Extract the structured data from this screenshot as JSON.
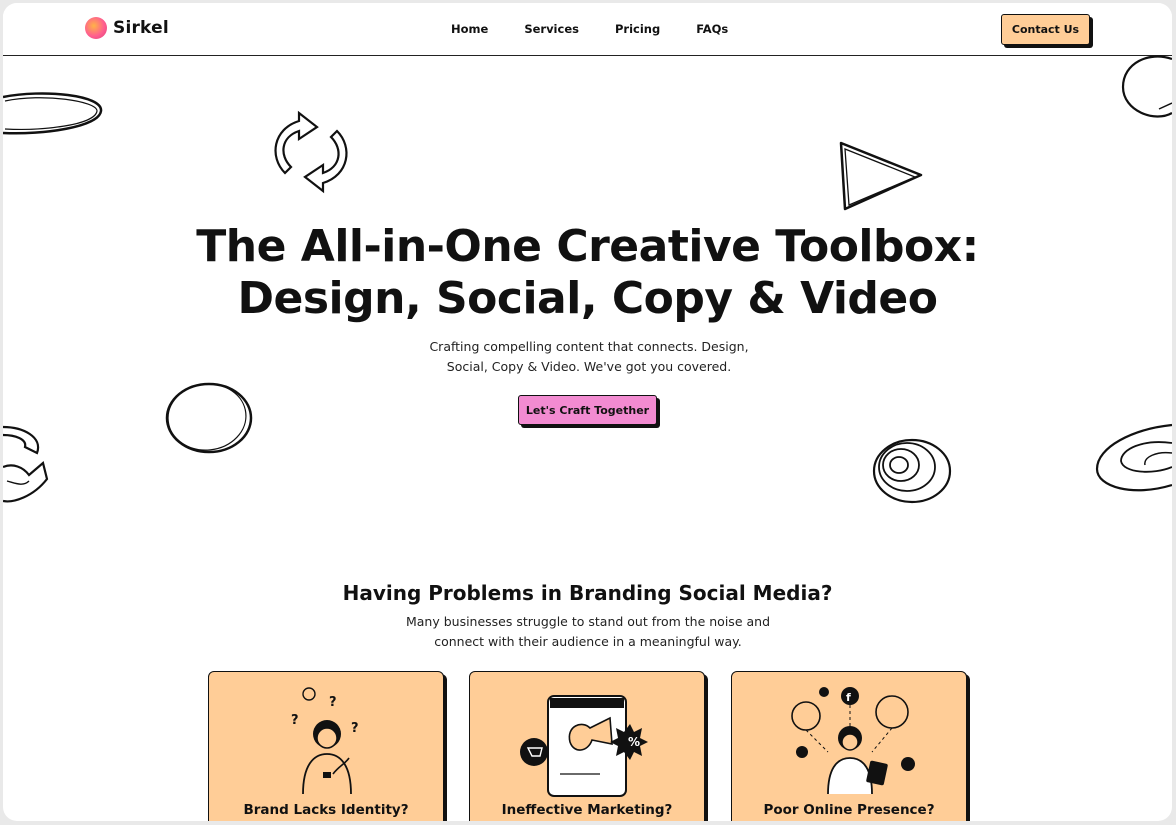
{
  "brand": {
    "name": "Sirkel"
  },
  "nav": {
    "items": [
      "Home",
      "Services",
      "Pricing",
      "FAQs"
    ]
  },
  "header": {
    "contact_label": "Contact Us"
  },
  "hero": {
    "title_line1": "The All-in-One Creative Toolbox:",
    "title_line2": "Design, Social, Copy & Video",
    "subtitle": "Crafting compelling content that connects. Design, Social, Copy & Video. We've got you covered.",
    "cta_label": "Let's Craft Together"
  },
  "problems": {
    "title": "Having Problems in Branding Social Media?",
    "subtitle": "Many businesses struggle to stand out from the noise and connect with their audience in a meaningful way.",
    "cards": [
      {
        "title": "Brand Lacks Identity?"
      },
      {
        "title": "Ineffective Marketing?"
      },
      {
        "title": "Poor Online Presence?"
      }
    ]
  },
  "colors": {
    "accent_orange": "#ffcd97",
    "accent_pink": "#f28bd1",
    "ink": "#111111"
  },
  "icons": [
    "logo-icon",
    "refresh-doodle-icon",
    "play-doodle-icon",
    "circle-doodle-icon",
    "spiral-doodle-icon",
    "scribble-doodle-icon",
    "arrow-doodle-icon",
    "confused-person-illustration",
    "megaphone-illustration",
    "social-network-illustration"
  ]
}
